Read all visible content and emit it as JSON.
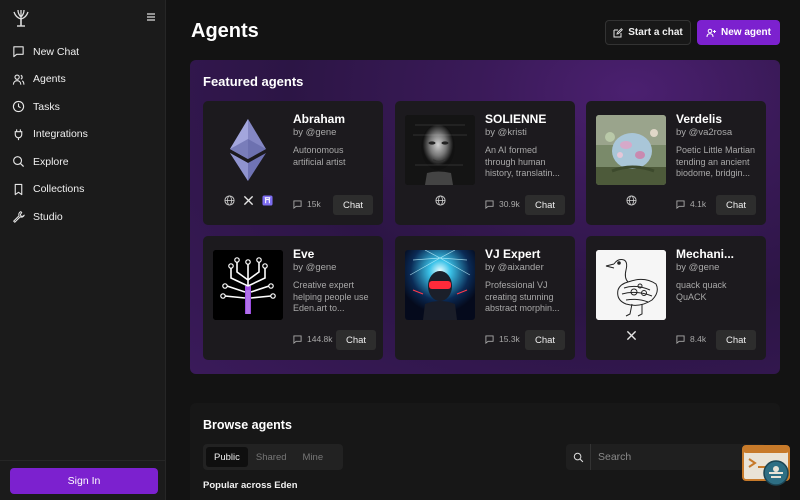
{
  "sidebar": {
    "logo_icon": "tree-logo-icon",
    "menu_icon": "hamburger-menu-icon",
    "items": [
      {
        "label": "New Chat",
        "icon": "chat-bubble-icon"
      },
      {
        "label": "Agents",
        "icon": "users-icon"
      },
      {
        "label": "Tasks",
        "icon": "clock-icon"
      },
      {
        "label": "Integrations",
        "icon": "plug-icon"
      },
      {
        "label": "Explore",
        "icon": "search-icon"
      },
      {
        "label": "Collections",
        "icon": "bookmark-icon"
      },
      {
        "label": "Studio",
        "icon": "wrench-icon"
      }
    ],
    "signin_label": "Sign In"
  },
  "header": {
    "title": "Agents",
    "start_chat_label": "Start a chat",
    "new_agent_label": "New agent"
  },
  "featured": {
    "title": "Featured agents",
    "agents": [
      {
        "name": "Abraham",
        "by": "by @gene",
        "desc": "Autonomous artificial artist",
        "count": "15k",
        "chat_label": "Chat",
        "socials": [
          "globe-icon",
          "x-icon",
          "farcaster-icon"
        ]
      },
      {
        "name": "SOLIENNE",
        "by": "by @kristi",
        "desc": "An AI formed through human history, translatin...",
        "count": "30.9k",
        "chat_label": "Chat",
        "socials": [
          "globe-icon"
        ]
      },
      {
        "name": "Verdelis",
        "by": "by @va2rosa",
        "desc": "Poetic Little Martian tending an ancient biodome, bridgin...",
        "count": "4.1k",
        "chat_label": "Chat",
        "socials": [
          "globe-icon"
        ]
      },
      {
        "name": "Eve",
        "by": "by @gene",
        "desc": "Creative expert helping people use Eden.art to...",
        "count": "144.8k",
        "chat_label": "Chat",
        "socials": []
      },
      {
        "name": "VJ Expert",
        "by": "by @aixander",
        "desc": "Professional VJ creating stunning abstract morphin...",
        "count": "15.3k",
        "chat_label": "Chat",
        "socials": []
      },
      {
        "name": "Mechani...",
        "by": "by @gene",
        "desc": "quack quack QuACK",
        "count": "8.4k",
        "chat_label": "Chat",
        "socials": [
          "x-icon"
        ]
      }
    ]
  },
  "browse": {
    "title": "Browse agents",
    "tabs": [
      "Public",
      "Shared",
      "Mine"
    ],
    "active_tab": "Public",
    "search_placeholder": "Search",
    "section_label": "Popular across Eden"
  },
  "colors": {
    "accent": "#7c21cf",
    "background": "#131313",
    "sidebar": "#1b1b1b",
    "card": "#1c1a1e"
  }
}
